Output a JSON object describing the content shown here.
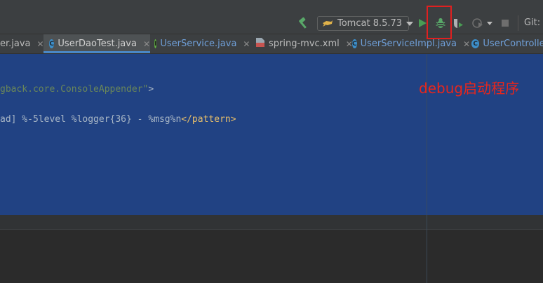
{
  "toolbar": {
    "run_config_label": "Tomcat 8.5.73",
    "git_label": "Git:",
    "icons": {
      "build": "hammer-icon",
      "run": "run-icon",
      "debug": "debug-bug-icon",
      "coverage": "coverage-icon",
      "profile": "profile-icon",
      "stop": "stop-icon"
    }
  },
  "tabs": [
    {
      "label": "er.java",
      "icon": "none",
      "active": false
    },
    {
      "label": "UserDaoTest.java",
      "icon": "class-icon",
      "active": true
    },
    {
      "label": "UserService.java",
      "icon": "interface-icon",
      "active": false
    },
    {
      "label": "spring-mvc.xml",
      "icon": "xml-file-icon",
      "active": false
    },
    {
      "label": "UserServiceImpl.java",
      "icon": "class-icon",
      "active": false
    },
    {
      "label": "UserController",
      "icon": "class-icon",
      "active": false
    }
  ],
  "editor": {
    "line1_str": "gback.core.ConsoleAppender\"",
    "line1_tag": ">",
    "line2_text": "ad] %-5level %logger{36} - %msg%n",
    "line2_tag": "</pattern>"
  },
  "annotation": {
    "text": "debug启动程序",
    "color": "#e8261c"
  },
  "colors": {
    "editor_selection": "#214283",
    "highlight_box": "#e02020",
    "run_green": "#499c54",
    "tab_text_blue": "#6f9fd8"
  }
}
